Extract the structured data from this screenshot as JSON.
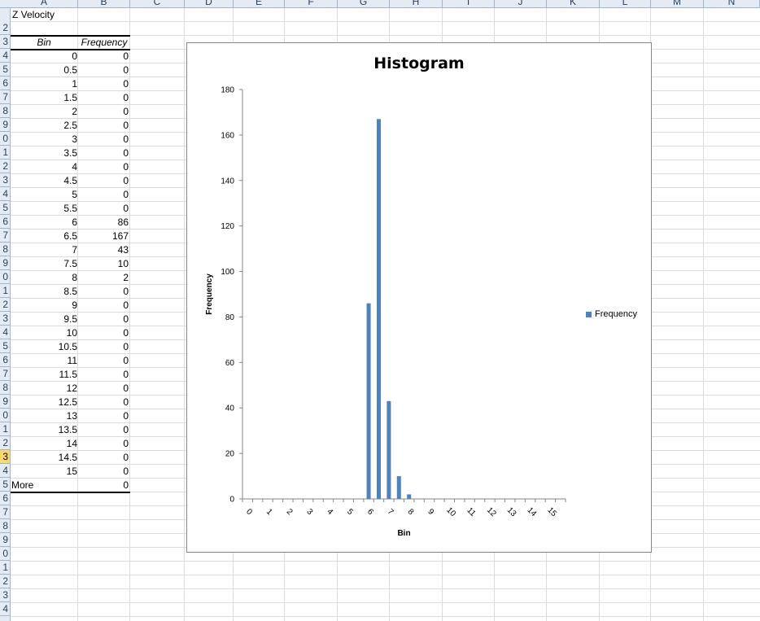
{
  "columns": [
    "A",
    "B",
    "C",
    "D",
    "E",
    "F",
    "G",
    "H",
    "I",
    "J",
    "K",
    "L",
    "M",
    "N"
  ],
  "row_numbers": [
    "2",
    "3",
    "4",
    "5",
    "6",
    "7",
    "8",
    "9",
    "0",
    "1",
    "2",
    "3",
    "4",
    "5",
    "6",
    "7",
    "8",
    "9",
    "0",
    "1",
    "2",
    "3",
    "4",
    "5",
    "6",
    "7",
    "8",
    "9",
    "0",
    "1",
    "2",
    "3",
    "4",
    "5",
    "6",
    "7",
    "8",
    "9",
    "0",
    "1",
    "2",
    "3",
    "4"
  ],
  "selected_row_label": "3",
  "sheet": {
    "title_cell": "Z Velocity",
    "table_headers": {
      "bin": "Bin",
      "frequency": "Frequency"
    },
    "bins": [
      "0",
      "0.5",
      "1",
      "1.5",
      "2",
      "2.5",
      "3",
      "3.5",
      "4",
      "4.5",
      "5",
      "5.5",
      "6",
      "6.5",
      "7",
      "7.5",
      "8",
      "8.5",
      "9",
      "9.5",
      "10",
      "10.5",
      "11",
      "11.5",
      "12",
      "12.5",
      "13",
      "13.5",
      "14",
      "14.5",
      "15",
      "More"
    ],
    "frequencies": [
      "0",
      "0",
      "0",
      "0",
      "0",
      "0",
      "0",
      "0",
      "0",
      "0",
      "0",
      "0",
      "86",
      "167",
      "43",
      "10",
      "2",
      "0",
      "0",
      "0",
      "0",
      "0",
      "0",
      "0",
      "0",
      "0",
      "0",
      "0",
      "0",
      "0",
      "0",
      "0"
    ]
  },
  "chart_data": {
    "type": "bar",
    "title": "Histogram",
    "xlabel": "Bin",
    "ylabel": "Frequency",
    "ylim": [
      0,
      180
    ],
    "yticks": [
      0,
      20,
      40,
      60,
      80,
      100,
      120,
      140,
      160,
      180
    ],
    "categories": [
      "0",
      "0.5",
      "1",
      "1.5",
      "2",
      "2.5",
      "3",
      "3.5",
      "4",
      "4.5",
      "5",
      "5.5",
      "6",
      "6.5",
      "7",
      "7.5",
      "8",
      "8.5",
      "9",
      "9.5",
      "10",
      "10.5",
      "11",
      "11.5",
      "12",
      "12.5",
      "13",
      "13.5",
      "14",
      "14.5",
      "15",
      "More"
    ],
    "tick_labels": [
      "0",
      "1",
      "2",
      "3",
      "4",
      "5",
      "6",
      "7",
      "8",
      "9",
      "10",
      "11",
      "12",
      "13",
      "14",
      "15"
    ],
    "series": [
      {
        "name": "Frequency",
        "values": [
          0,
          0,
          0,
          0,
          0,
          0,
          0,
          0,
          0,
          0,
          0,
          0,
          86,
          167,
          43,
          10,
          2,
          0,
          0,
          0,
          0,
          0,
          0,
          0,
          0,
          0,
          0,
          0,
          0,
          0,
          0,
          0
        ]
      }
    ],
    "legend_placement": "right",
    "grid": false,
    "bar_color": "#4f81bd"
  }
}
